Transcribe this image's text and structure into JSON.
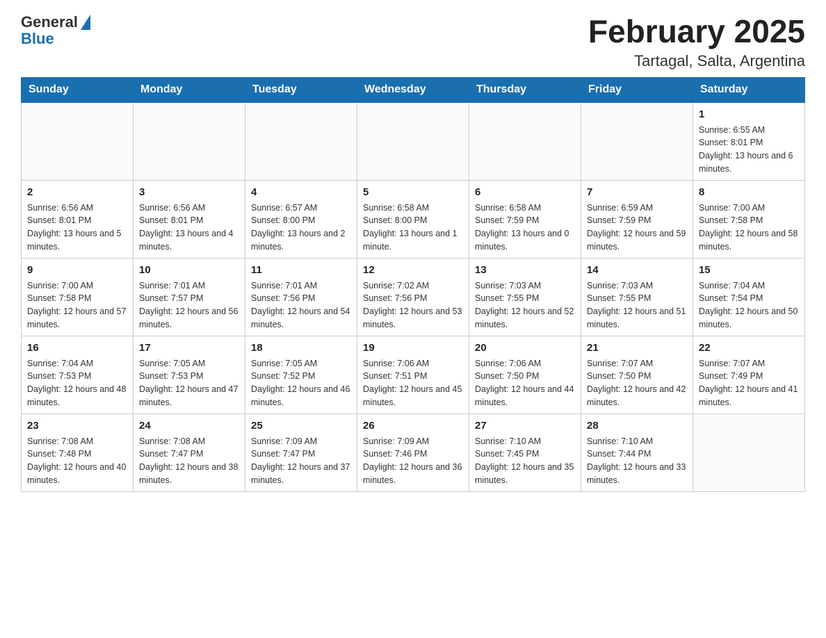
{
  "header": {
    "logo_general": "General",
    "logo_blue": "Blue",
    "title": "February 2025",
    "subtitle": "Tartagal, Salta, Argentina"
  },
  "days_of_week": [
    "Sunday",
    "Monday",
    "Tuesday",
    "Wednesday",
    "Thursday",
    "Friday",
    "Saturday"
  ],
  "weeks": [
    [
      {
        "day": "",
        "sunrise": "",
        "sunset": "",
        "daylight": ""
      },
      {
        "day": "",
        "sunrise": "",
        "sunset": "",
        "daylight": ""
      },
      {
        "day": "",
        "sunrise": "",
        "sunset": "",
        "daylight": ""
      },
      {
        "day": "",
        "sunrise": "",
        "sunset": "",
        "daylight": ""
      },
      {
        "day": "",
        "sunrise": "",
        "sunset": "",
        "daylight": ""
      },
      {
        "day": "",
        "sunrise": "",
        "sunset": "",
        "daylight": ""
      },
      {
        "day": "1",
        "sunrise": "Sunrise: 6:55 AM",
        "sunset": "Sunset: 8:01 PM",
        "daylight": "Daylight: 13 hours and 6 minutes."
      }
    ],
    [
      {
        "day": "2",
        "sunrise": "Sunrise: 6:56 AM",
        "sunset": "Sunset: 8:01 PM",
        "daylight": "Daylight: 13 hours and 5 minutes."
      },
      {
        "day": "3",
        "sunrise": "Sunrise: 6:56 AM",
        "sunset": "Sunset: 8:01 PM",
        "daylight": "Daylight: 13 hours and 4 minutes."
      },
      {
        "day": "4",
        "sunrise": "Sunrise: 6:57 AM",
        "sunset": "Sunset: 8:00 PM",
        "daylight": "Daylight: 13 hours and 2 minutes."
      },
      {
        "day": "5",
        "sunrise": "Sunrise: 6:58 AM",
        "sunset": "Sunset: 8:00 PM",
        "daylight": "Daylight: 13 hours and 1 minute."
      },
      {
        "day": "6",
        "sunrise": "Sunrise: 6:58 AM",
        "sunset": "Sunset: 7:59 PM",
        "daylight": "Daylight: 13 hours and 0 minutes."
      },
      {
        "day": "7",
        "sunrise": "Sunrise: 6:59 AM",
        "sunset": "Sunset: 7:59 PM",
        "daylight": "Daylight: 12 hours and 59 minutes."
      },
      {
        "day": "8",
        "sunrise": "Sunrise: 7:00 AM",
        "sunset": "Sunset: 7:58 PM",
        "daylight": "Daylight: 12 hours and 58 minutes."
      }
    ],
    [
      {
        "day": "9",
        "sunrise": "Sunrise: 7:00 AM",
        "sunset": "Sunset: 7:58 PM",
        "daylight": "Daylight: 12 hours and 57 minutes."
      },
      {
        "day": "10",
        "sunrise": "Sunrise: 7:01 AM",
        "sunset": "Sunset: 7:57 PM",
        "daylight": "Daylight: 12 hours and 56 minutes."
      },
      {
        "day": "11",
        "sunrise": "Sunrise: 7:01 AM",
        "sunset": "Sunset: 7:56 PM",
        "daylight": "Daylight: 12 hours and 54 minutes."
      },
      {
        "day": "12",
        "sunrise": "Sunrise: 7:02 AM",
        "sunset": "Sunset: 7:56 PM",
        "daylight": "Daylight: 12 hours and 53 minutes."
      },
      {
        "day": "13",
        "sunrise": "Sunrise: 7:03 AM",
        "sunset": "Sunset: 7:55 PM",
        "daylight": "Daylight: 12 hours and 52 minutes."
      },
      {
        "day": "14",
        "sunrise": "Sunrise: 7:03 AM",
        "sunset": "Sunset: 7:55 PM",
        "daylight": "Daylight: 12 hours and 51 minutes."
      },
      {
        "day": "15",
        "sunrise": "Sunrise: 7:04 AM",
        "sunset": "Sunset: 7:54 PM",
        "daylight": "Daylight: 12 hours and 50 minutes."
      }
    ],
    [
      {
        "day": "16",
        "sunrise": "Sunrise: 7:04 AM",
        "sunset": "Sunset: 7:53 PM",
        "daylight": "Daylight: 12 hours and 48 minutes."
      },
      {
        "day": "17",
        "sunrise": "Sunrise: 7:05 AM",
        "sunset": "Sunset: 7:53 PM",
        "daylight": "Daylight: 12 hours and 47 minutes."
      },
      {
        "day": "18",
        "sunrise": "Sunrise: 7:05 AM",
        "sunset": "Sunset: 7:52 PM",
        "daylight": "Daylight: 12 hours and 46 minutes."
      },
      {
        "day": "19",
        "sunrise": "Sunrise: 7:06 AM",
        "sunset": "Sunset: 7:51 PM",
        "daylight": "Daylight: 12 hours and 45 minutes."
      },
      {
        "day": "20",
        "sunrise": "Sunrise: 7:06 AM",
        "sunset": "Sunset: 7:50 PM",
        "daylight": "Daylight: 12 hours and 44 minutes."
      },
      {
        "day": "21",
        "sunrise": "Sunrise: 7:07 AM",
        "sunset": "Sunset: 7:50 PM",
        "daylight": "Daylight: 12 hours and 42 minutes."
      },
      {
        "day": "22",
        "sunrise": "Sunrise: 7:07 AM",
        "sunset": "Sunset: 7:49 PM",
        "daylight": "Daylight: 12 hours and 41 minutes."
      }
    ],
    [
      {
        "day": "23",
        "sunrise": "Sunrise: 7:08 AM",
        "sunset": "Sunset: 7:48 PM",
        "daylight": "Daylight: 12 hours and 40 minutes."
      },
      {
        "day": "24",
        "sunrise": "Sunrise: 7:08 AM",
        "sunset": "Sunset: 7:47 PM",
        "daylight": "Daylight: 12 hours and 38 minutes."
      },
      {
        "day": "25",
        "sunrise": "Sunrise: 7:09 AM",
        "sunset": "Sunset: 7:47 PM",
        "daylight": "Daylight: 12 hours and 37 minutes."
      },
      {
        "day": "26",
        "sunrise": "Sunrise: 7:09 AM",
        "sunset": "Sunset: 7:46 PM",
        "daylight": "Daylight: 12 hours and 36 minutes."
      },
      {
        "day": "27",
        "sunrise": "Sunrise: 7:10 AM",
        "sunset": "Sunset: 7:45 PM",
        "daylight": "Daylight: 12 hours and 35 minutes."
      },
      {
        "day": "28",
        "sunrise": "Sunrise: 7:10 AM",
        "sunset": "Sunset: 7:44 PM",
        "daylight": "Daylight: 12 hours and 33 minutes."
      },
      {
        "day": "",
        "sunrise": "",
        "sunset": "",
        "daylight": ""
      }
    ]
  ]
}
